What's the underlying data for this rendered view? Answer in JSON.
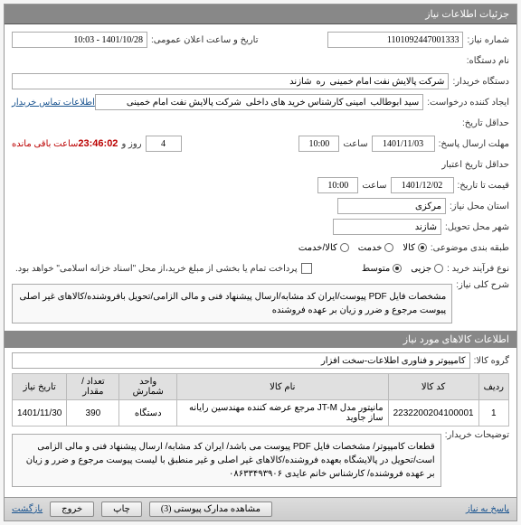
{
  "header": {
    "title": "جزئیات اطلاعات نیاز"
  },
  "fields": {
    "need_no_label": "شماره نیاز:",
    "need_no": "1101092447001333",
    "public_date_label": "تاریخ و ساعت اعلان عمومی:",
    "public_date": "1401/10/28 - 10:03",
    "device_label": "نام دستگاه:",
    "buyer_label": "دستگاه خریدار:",
    "buyer": "شرکت پالایش نفت امام خمینی  ره  شازند",
    "requester_label": "ایجاد کننده درخواست:",
    "requester": "سید ابوطالب  امینی کارشناس خرید های داخلی  شرکت پالایش نفت امام خمینی",
    "contact_link": "اطلاعات تماس خریدار",
    "deadline_label": "حداقل تاریخ:",
    "response_deadline_label": "مهلت ارسال پاسخ:",
    "response_date": "1401/11/03",
    "time_label": "ساعت",
    "response_time": "10:00",
    "days": "4",
    "days_label": "روز و",
    "countdown": "23:46:02",
    "remaining": "ساعت باقی مانده",
    "validity_label": "حداقل تاریخ اعتبار",
    "price_until_label": "قیمت تا تاریخ:",
    "validity_date": "1401/12/02",
    "validity_time": "10:00",
    "need_place_label": "استان محل نیاز:",
    "need_place": "مرکزی",
    "delivery_city_label": "شهر محل تحویل:",
    "delivery_city": "شازند",
    "subject_class_label": "طبقه بندی موضوعی:",
    "subject_goods": "کالا",
    "subject_service": "خدمت",
    "subject_goods_service": "کالا/خدمت",
    "buy_process_label": "نوع فرآیند خرید :",
    "buy_low": "جزیی",
    "buy_mid": "متوسط",
    "partial_pay_label": "پرداخت تمام یا بخشی از مبلغ خرید،از محل \"اسناد خزانه اسلامی\" خواهد بود.",
    "general_desc_label": "شرح کلی نیاز:",
    "general_desc": "مشخصات فایل PDF پیوست/ایران کد مشابه/ارسال پیشنهاد فنی و مالی الزامی/تحویل بافروشنده/کالاهای غیر اصلی پیوست مرجوع و ضرر و زیان بر عهده فروشنده",
    "goods_info_header": "اطلاعات کالاهای مورد نیاز",
    "goods_group_label": "گروه کالا:",
    "goods_group": "کامپیوتر و فناوری اطلاعات-سخت افزار",
    "buyer_notes_label": "توضیحات خریدار:",
    "buyer_notes": "قطعات کامپیوتر/ مشخصات فایل PDF پیوست می باشد/ ایران کد مشابه/ ارسال پیشنهاد فنی و مالی الزامی است/تحویل در پالایشگاه بعهده فروشنده/کالاهای غیر اصلی و غیر منطبق با لیست پیوست مرجوع و ضرر و زیان بر عهده فروشنده/ کارشناس خانم عایدی ۰۸۶۳۳۴۹۳۹۰۶"
  },
  "table": {
    "headers": {
      "row": "ردیف",
      "code": "کد کالا",
      "name": "نام کالا",
      "unit": "واحد شمارش",
      "qty": "تعداد / مقدار",
      "date": "تاریخ نیاز"
    },
    "rows": [
      {
        "idx": "1",
        "code": "2232200204100001",
        "name": "مانیتور مدل JT-M مرجع عرضه کننده مهندسین رایانه ساز جاوید",
        "unit": "دستگاه",
        "qty": "390",
        "date": "1401/11/30"
      }
    ]
  },
  "footer": {
    "back": "بازگشت",
    "attach": "مشاهده مدارک پیوستی (3)",
    "print": "چاپ",
    "exit": "خروج",
    "reply": "پاسخ به نیاز"
  }
}
